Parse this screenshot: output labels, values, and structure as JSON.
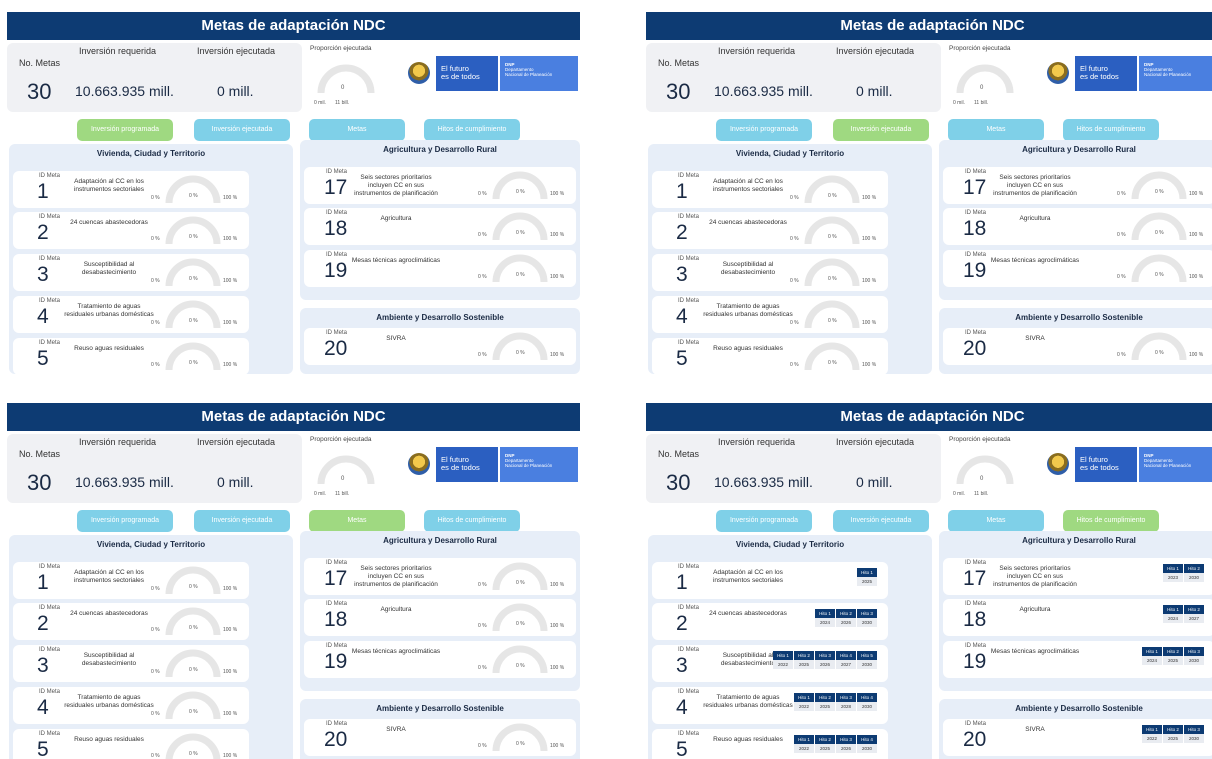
{
  "panels": [
    {
      "active_tab": 0
    },
    {
      "active_tab": 1
    },
    {
      "active_tab": 2
    },
    {
      "active_tab": 3
    }
  ],
  "dashboard": {
    "title": "Metas de adaptación NDC",
    "kpis": {
      "num_metas_label": "No. Metas",
      "num_metas_value": "30",
      "inv_req_label": "Inversión requerida",
      "inv_req_value": "10.663.935 mill.",
      "inv_ejec_label": "Inversión ejecutada",
      "inv_ejec_value": "0 mill."
    },
    "proporcion": {
      "label": "Proporción ejecutada",
      "value": "0",
      "min": "0 mil.",
      "max": "11 bill."
    },
    "logo": {
      "line1": "El futuro",
      "line2": "es de todos",
      "dnp": "DNP",
      "dnp_line1": "Departamento",
      "dnp_line2": "Nacional de Planeación"
    },
    "tabs": [
      "Inversión programada",
      "Inversión ejecutada",
      "Metas",
      "Hitos de cumplimiento"
    ],
    "id_label": "ID Meta",
    "gauge": {
      "min": "0 %",
      "value": "0 %",
      "max": "100 %"
    },
    "sections": {
      "vivienda": "Vivienda, Ciudad y Territorio",
      "agricultura": "Agricultura y Desarrollo Rural",
      "ambiente": "Ambiente y Desarrollo Sostenible"
    },
    "metas": [
      {
        "id": "1",
        "desc": "Adaptación al CC en los instrumentos sectoriales"
      },
      {
        "id": "2",
        "desc": "24 cuencas abastecedoras"
      },
      {
        "id": "3",
        "desc": "Susceptibilidad al desabastecimiento"
      },
      {
        "id": "4",
        "desc": "Tratamiento de aguas residuales urbanas domésticas"
      },
      {
        "id": "5",
        "desc": "Reuso aguas residuales"
      },
      {
        "id": "17",
        "desc": "Seis sectores prioritarios incluyen CC en sus instrumentos de planificación"
      },
      {
        "id": "18",
        "desc": "Agricultura"
      },
      {
        "id": "19",
        "desc": "Mesas técnicas agroclimáticas"
      },
      {
        "id": "20",
        "desc": "SIVRA"
      }
    ],
    "hitos": {
      "1": {
        "hitos": [
          "Hito 1"
        ],
        "years": [
          "2025"
        ]
      },
      "2": {
        "hitos": [
          "Hito 1",
          "Hito 2",
          "Hito 3"
        ],
        "years": [
          "2024",
          "2026",
          "2030"
        ]
      },
      "3": {
        "hitos": [
          "Hito 1",
          "Hito 2",
          "Hito 3",
          "Hito 4",
          "Hito 5"
        ],
        "years": [
          "2022",
          "2025",
          "2026",
          "2027",
          "2030"
        ]
      },
      "4": {
        "hitos": [
          "Hito 1",
          "Hito 2",
          "Hito 3",
          "Hito 4"
        ],
        "years": [
          "2022",
          "2025",
          "2028",
          "2030"
        ]
      },
      "5": {
        "hitos": [
          "Hito 1",
          "Hito 2",
          "Hito 3",
          "Hito 4"
        ],
        "years": [
          "2022",
          "2025",
          "2026",
          "2030"
        ]
      },
      "17": {
        "hitos": [
          "Hito 1",
          "Hito 2"
        ],
        "years": [
          "2023",
          "2030"
        ]
      },
      "18": {
        "hitos": [
          "Hito 1",
          "Hito 2"
        ],
        "years": [
          "2024",
          "2027"
        ]
      },
      "19": {
        "hitos": [
          "Hito 1",
          "Hito 2",
          "Hito 3"
        ],
        "years": [
          "2024",
          "2025",
          "2030"
        ]
      },
      "20": {
        "hitos": [
          "Hito 1",
          "Hito 2",
          "Hito 3"
        ],
        "years": [
          "2022",
          "2025",
          "2030"
        ]
      }
    },
    "colors": {
      "header": "#0d3b73",
      "tab_default": "#7fd0e8",
      "tab_active": "#9fd981",
      "section_bg": "#e7eef8"
    }
  }
}
